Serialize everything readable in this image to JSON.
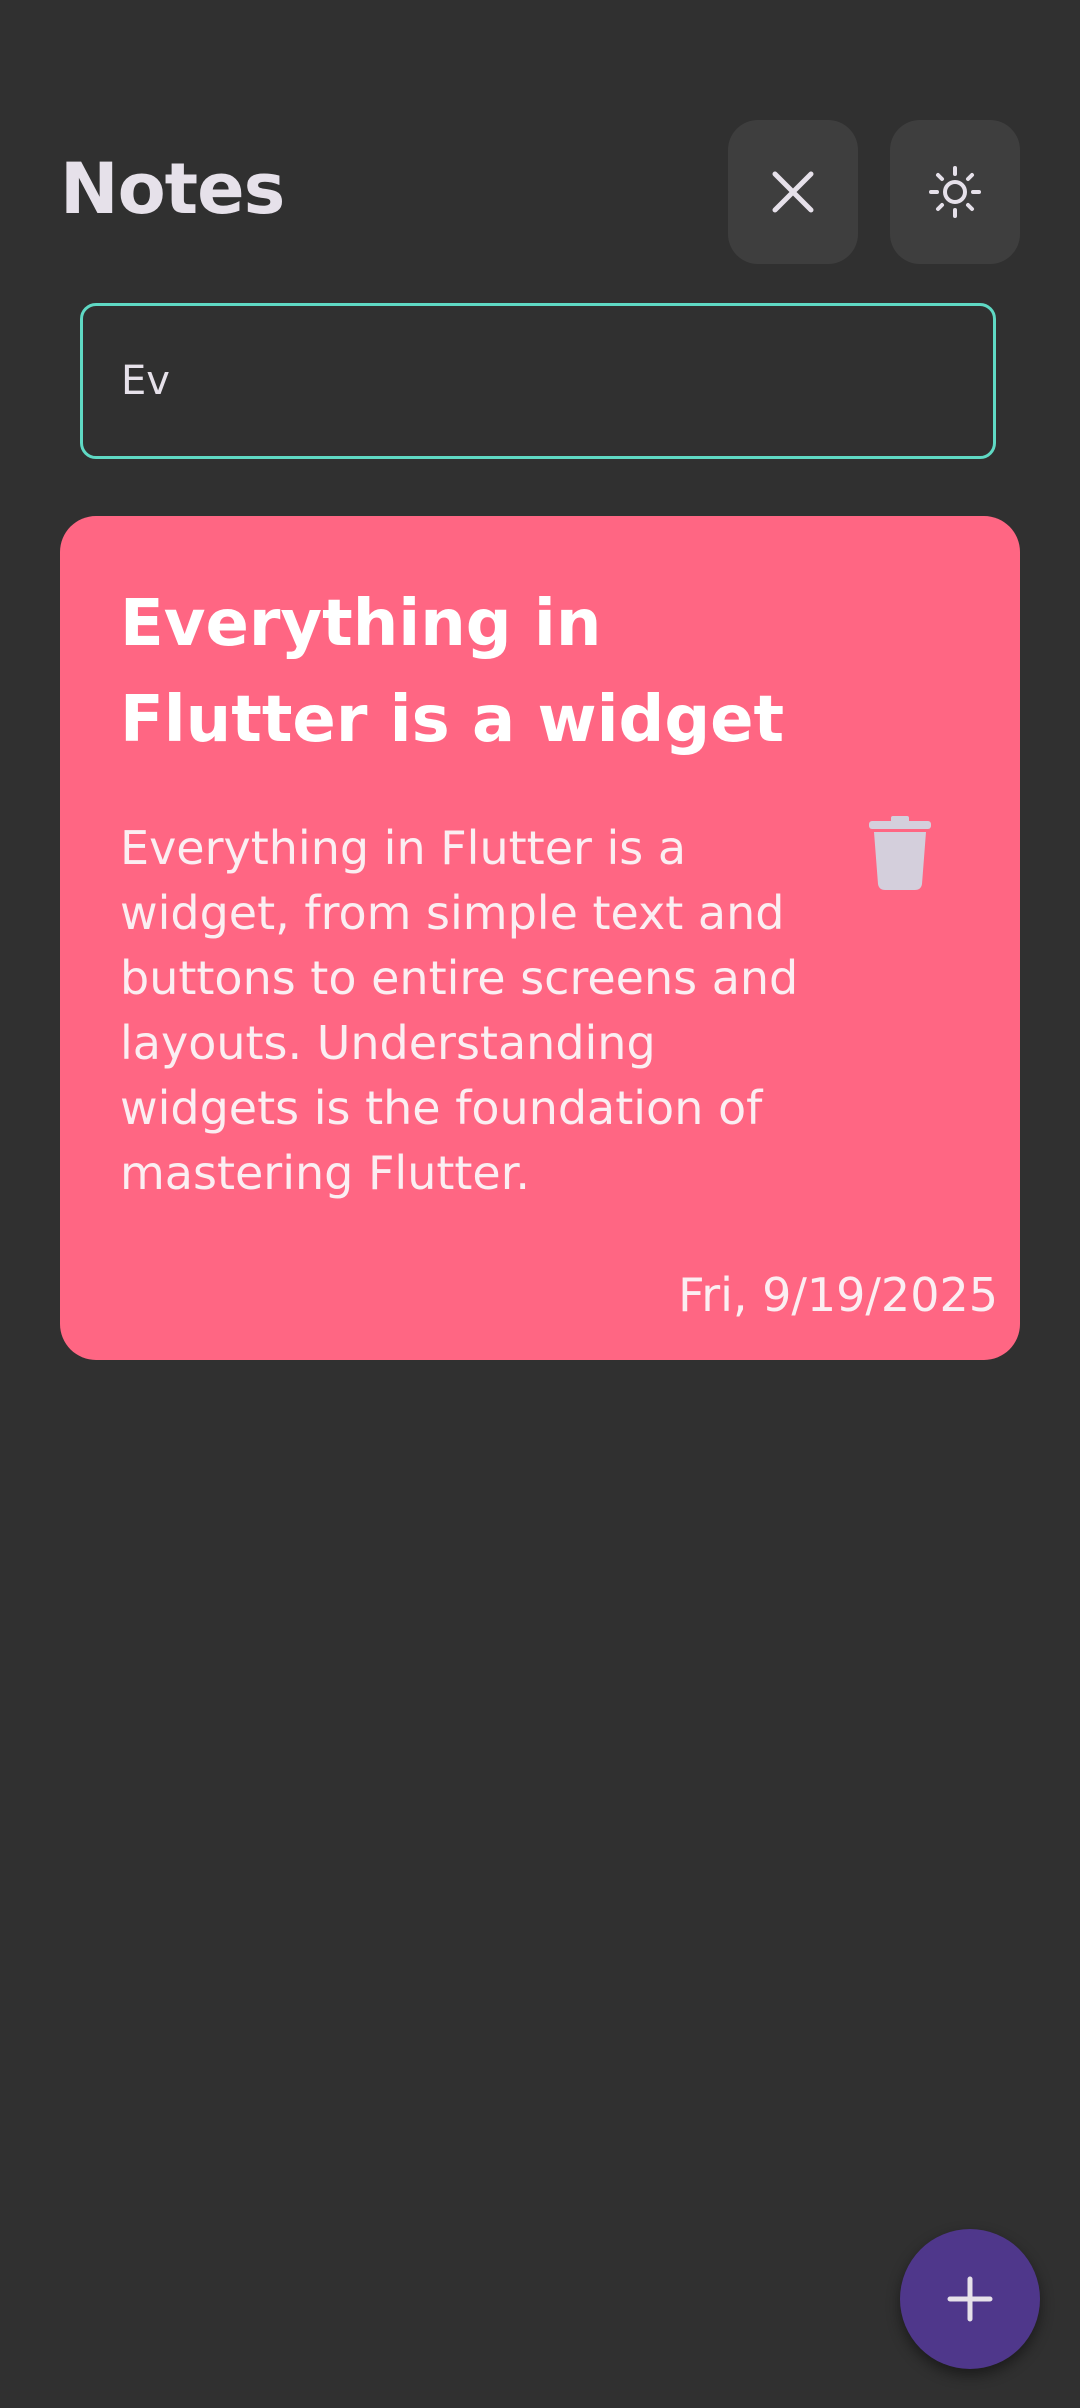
{
  "header": {
    "title": "Notes",
    "clear_icon": "close-icon",
    "theme_icon": "sun-icon"
  },
  "search": {
    "value": "Ev"
  },
  "notes": [
    {
      "title": "Everything in Flutter is a widget",
      "body": "Everything in Flutter is a widget, from simple text and buttons to entire screens and layouts. Understanding widgets is the foundation of mastering Flutter.",
      "date": "Fri, 9/19/2025",
      "color": "#ff6683",
      "delete_icon": "trash-icon"
    }
  ],
  "fab": {
    "icon": "plus-icon",
    "color": "#4f378b"
  },
  "colors": {
    "background": "#303030",
    "accent_border": "#5fd9c4",
    "text": "#e6e1ea"
  }
}
